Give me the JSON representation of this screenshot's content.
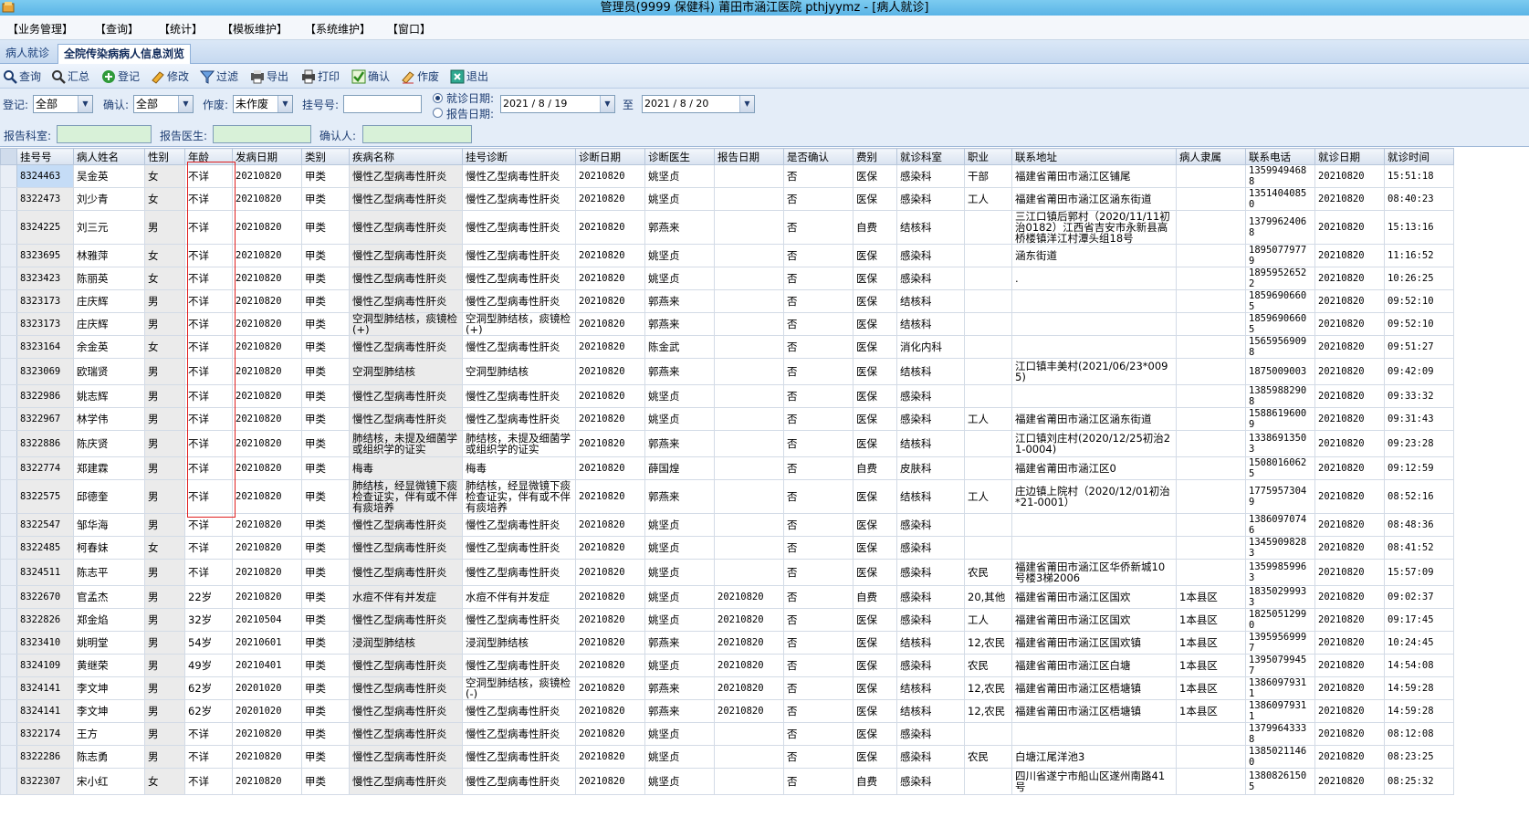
{
  "window": {
    "title": "管理员(9999 保健科) 莆田市涵江医院 pthjyymz - [病人就诊]"
  },
  "menu": [
    "【业务管理】",
    "【查询】",
    "【统计】",
    "【模板维护】",
    "【系统维护】",
    "【窗口】"
  ],
  "tabs": [
    {
      "label": "病人就诊",
      "active": false
    },
    {
      "label": "全院传染病病人信息浏览",
      "active": true
    }
  ],
  "toolbar": [
    {
      "label": "查询",
      "icon": "search-icon"
    },
    {
      "label": "汇总",
      "icon": "summary-icon"
    },
    {
      "label": "登记",
      "icon": "register-icon"
    },
    {
      "label": "修改",
      "icon": "edit-icon"
    },
    {
      "label": "过滤",
      "icon": "filter-icon"
    },
    {
      "label": "导出",
      "icon": "export-icon"
    },
    {
      "label": "打印",
      "icon": "print-icon"
    },
    {
      "label": "确认",
      "icon": "confirm-icon"
    },
    {
      "label": "作废",
      "icon": "void-icon"
    },
    {
      "label": "退出",
      "icon": "exit-icon"
    }
  ],
  "filters": {
    "register_label": "登记:",
    "register_value": "全部",
    "confirm_label": "确认:",
    "confirm_value": "全部",
    "void_label": "作废:",
    "void_value": "未作废",
    "regno_label": "挂号号:",
    "regno_value": "",
    "visit_date_label": "就诊日期:",
    "report_date_label": "报告日期:",
    "date_from": "2021 / 8 / 19",
    "to_label": "至",
    "date_to": "2021 / 8 / 20",
    "report_dept_label": "报告科室:",
    "report_doctor_label": "报告医生:",
    "confirmer_label": "确认人:"
  },
  "columns": [
    "挂号号",
    "病人姓名",
    "性别",
    "年龄",
    "发病日期",
    "类别",
    "疾病名称",
    "挂号诊断",
    "诊断日期",
    "诊断医生",
    "报告日期",
    "是否确认",
    "费别",
    "就诊科室",
    "职业",
    "联系地址",
    "病人隶属",
    "联系电话",
    "就诊日期",
    "就诊时间"
  ],
  "rows": [
    [
      "8324463",
      "吴金英",
      "女",
      "不详",
      "20210820",
      "甲类",
      "慢性乙型病毒性肝炎",
      "慢性乙型病毒性肝炎",
      "20210820",
      "姚坚贞",
      "",
      "否",
      "医保",
      "感染科",
      "干部",
      "福建省莆田市涵江区铺尾",
      "",
      "13599494688",
      "20210820",
      "15:51:18"
    ],
    [
      "8322473",
      "刘少青",
      "女",
      "不详",
      "20210820",
      "甲类",
      "慢性乙型病毒性肝炎",
      "慢性乙型病毒性肝炎",
      "20210820",
      "姚坚贞",
      "",
      "否",
      "医保",
      "感染科",
      "工人",
      "福建省莆田市涵江区涵东街道",
      "",
      "13514040850",
      "20210820",
      "08:40:23"
    ],
    [
      "8324225",
      "刘三元",
      "男",
      "不详",
      "20210820",
      "甲类",
      "慢性乙型病毒性肝炎",
      "慢性乙型病毒性肝炎",
      "20210820",
      "郭燕来",
      "",
      "否",
      "自费",
      "结核科",
      "",
      "三江口镇后郭村（2020/11/11初治0182）江西省吉安市永新县高桥楼镇洋江村潭头组18号",
      "",
      "13799624068",
      "20210820",
      "15:13:16"
    ],
    [
      "8323695",
      "林雅萍",
      "女",
      "不详",
      "20210820",
      "甲类",
      "慢性乙型病毒性肝炎",
      "慢性乙型病毒性肝炎",
      "20210820",
      "姚坚贞",
      "",
      "否",
      "医保",
      "感染科",
      "",
      "涵东街道",
      "",
      "18950779779",
      "20210820",
      "11:16:52"
    ],
    [
      "8323423",
      "陈丽英",
      "女",
      "不详",
      "20210820",
      "甲类",
      "慢性乙型病毒性肝炎",
      "慢性乙型病毒性肝炎",
      "20210820",
      "姚坚贞",
      "",
      "否",
      "医保",
      "感染科",
      "",
      ".",
      "",
      "18959526522",
      "20210820",
      "10:26:25"
    ],
    [
      "8323173",
      "庄庆辉",
      "男",
      "不详",
      "20210820",
      "甲类",
      "慢性乙型病毒性肝炎",
      "慢性乙型病毒性肝炎",
      "20210820",
      "郭燕来",
      "",
      "否",
      "医保",
      "结核科",
      "",
      "",
      "",
      "18596906605",
      "20210820",
      "09:52:10"
    ],
    [
      "8323173",
      "庄庆辉",
      "男",
      "不详",
      "20210820",
      "甲类",
      "空洞型肺结核，痰镜检(+)",
      "空洞型肺结核，痰镜检(+)",
      "20210820",
      "郭燕来",
      "",
      "否",
      "医保",
      "结核科",
      "",
      "",
      "",
      "18596906605",
      "20210820",
      "09:52:10"
    ],
    [
      "8323164",
      "余金英",
      "女",
      "不详",
      "20210820",
      "甲类",
      "慢性乙型病毒性肝炎",
      "慢性乙型病毒性肝炎",
      "20210820",
      "陈金武",
      "",
      "否",
      "医保",
      "消化内科",
      "",
      "",
      "",
      "15659569098",
      "20210820",
      "09:51:27"
    ],
    [
      "8323069",
      "欧瑞贤",
      "男",
      "不详",
      "20210820",
      "甲类",
      "空洞型肺结核",
      "空洞型肺结核",
      "20210820",
      "郭燕来",
      "",
      "否",
      "医保",
      "结核科",
      "",
      "江口镇丰美村(2021/06/23*0095)",
      "",
      "1875009003",
      "20210820",
      "09:42:09"
    ],
    [
      "8322986",
      "姚志辉",
      "男",
      "不详",
      "20210820",
      "甲类",
      "慢性乙型病毒性肝炎",
      "慢性乙型病毒性肝炎",
      "20210820",
      "姚坚贞",
      "",
      "否",
      "医保",
      "感染科",
      "",
      "",
      "",
      "13859882908",
      "20210820",
      "09:33:32"
    ],
    [
      "8322967",
      "林学伟",
      "男",
      "不详",
      "20210820",
      "甲类",
      "慢性乙型病毒性肝炎",
      "慢性乙型病毒性肝炎",
      "20210820",
      "姚坚贞",
      "",
      "否",
      "医保",
      "感染科",
      "工人",
      "福建省莆田市涵江区涵东街道",
      "",
      "15886196009",
      "20210820",
      "09:31:43"
    ],
    [
      "8322886",
      "陈庆贤",
      "男",
      "不详",
      "20210820",
      "甲类",
      "肺结核，未提及细菌学或组织学的证实",
      "肺结核，未提及细菌学或组织学的证实",
      "20210820",
      "郭燕来",
      "",
      "否",
      "医保",
      "结核科",
      "",
      "江口镇刘庄村(2020/12/25初治21-0004)",
      "",
      "13386913503",
      "20210820",
      "09:23:28"
    ],
    [
      "8322774",
      "郑建霖",
      "男",
      "不详",
      "20210820",
      "甲类",
      "梅毒",
      "梅毒",
      "20210820",
      "薛国煌",
      "",
      "否",
      "自费",
      "皮肤科",
      "",
      "福建省莆田市涵江区0",
      "",
      "15080160625",
      "20210820",
      "09:12:59"
    ],
    [
      "8322575",
      "邱德奎",
      "男",
      "不详",
      "20210820",
      "甲类",
      "肺结核，经显微镜下痰检查证实，伴有或不伴有痰培养",
      "肺结核，经显微镜下痰检查证实，伴有或不伴有痰培养",
      "20210820",
      "郭燕来",
      "",
      "否",
      "医保",
      "结核科",
      "工人",
      "庄边镇上院村（2020/12/01初治*21-0001）",
      "",
      "17759573049",
      "20210820",
      "08:52:16"
    ],
    [
      "8322547",
      "邹华海",
      "男",
      "不详",
      "20210820",
      "甲类",
      "慢性乙型病毒性肝炎",
      "慢性乙型病毒性肝炎",
      "20210820",
      "姚坚贞",
      "",
      "否",
      "医保",
      "感染科",
      "",
      "",
      "",
      "13860970746",
      "20210820",
      "08:48:36"
    ],
    [
      "8322485",
      "柯春妹",
      "女",
      "不详",
      "20210820",
      "甲类",
      "慢性乙型病毒性肝炎",
      "慢性乙型病毒性肝炎",
      "20210820",
      "姚坚贞",
      "",
      "否",
      "医保",
      "感染科",
      "",
      "",
      "",
      "13459098283",
      "20210820",
      "08:41:52"
    ],
    [
      "8324511",
      "陈志平",
      "男",
      "不详",
      "20210820",
      "甲类",
      "慢性乙型病毒性肝炎",
      "慢性乙型病毒性肝炎",
      "20210820",
      "姚坚贞",
      "",
      "否",
      "医保",
      "感染科",
      "农民",
      "福建省莆田市涵江区华侨新城10号楼3梯2006",
      "",
      "13599859963",
      "20210820",
      "15:57:09"
    ],
    [
      "8322670",
      "官孟杰",
      "男",
      "22岁",
      "20210820",
      "甲类",
      "水痘不伴有并发症",
      "水痘不伴有并发症",
      "20210820",
      "姚坚贞",
      "20210820",
      "否",
      "自费",
      "感染科",
      "20,其他",
      "福建省莆田市涵江区国欢",
      "1本县区",
      "18350299933",
      "20210820",
      "09:02:37"
    ],
    [
      "8322826",
      "郑金焰",
      "男",
      "32岁",
      "20210504",
      "甲类",
      "慢性乙型病毒性肝炎",
      "慢性乙型病毒性肝炎",
      "20210820",
      "姚坚贞",
      "20210820",
      "否",
      "医保",
      "感染科",
      "工人",
      "福建省莆田市涵江区国欢",
      "1本县区",
      "18250512990",
      "20210820",
      "09:17:45"
    ],
    [
      "8323410",
      "姚明堂",
      "男",
      "54岁",
      "20210601",
      "甲类",
      "浸润型肺结核",
      "浸润型肺结核",
      "20210820",
      "郭燕来",
      "20210820",
      "否",
      "医保",
      "结核科",
      "12,农民",
      "福建省莆田市涵江区国欢镇",
      "1本县区",
      "13959569997",
      "20210820",
      "10:24:45"
    ],
    [
      "8324109",
      "黄继荣",
      "男",
      "49岁",
      "20210401",
      "甲类",
      "慢性乙型病毒性肝炎",
      "慢性乙型病毒性肝炎",
      "20210820",
      "姚坚贞",
      "20210820",
      "否",
      "医保",
      "感染科",
      "农民",
      "福建省莆田市涵江区白塘",
      "1本县区",
      "13950799457",
      "20210820",
      "14:54:08"
    ],
    [
      "8324141",
      "李文坤",
      "男",
      "62岁",
      "20201020",
      "甲类",
      "慢性乙型病毒性肝炎",
      "空洞型肺结核，痰镜检(-)",
      "20210820",
      "郭燕来",
      "20210820",
      "否",
      "医保",
      "结核科",
      "12,农民",
      "福建省莆田市涵江区梧塘镇",
      "1本县区",
      "13860979311",
      "20210820",
      "14:59:28"
    ],
    [
      "8324141",
      "李文坤",
      "男",
      "62岁",
      "20201020",
      "甲类",
      "慢性乙型病毒性肝炎",
      "慢性乙型病毒性肝炎",
      "20210820",
      "郭燕来",
      "20210820",
      "否",
      "医保",
      "结核科",
      "12,农民",
      "福建省莆田市涵江区梧塘镇",
      "1本县区",
      "13860979311",
      "20210820",
      "14:59:28"
    ],
    [
      "8322174",
      "王方",
      "男",
      "不详",
      "20210820",
      "甲类",
      "慢性乙型病毒性肝炎",
      "慢性乙型病毒性肝炎",
      "20210820",
      "姚坚贞",
      "",
      "否",
      "医保",
      "感染科",
      "",
      "",
      "",
      "13799643338",
      "20210820",
      "08:12:08"
    ],
    [
      "8322286",
      "陈志勇",
      "男",
      "不详",
      "20210820",
      "甲类",
      "慢性乙型病毒性肝炎",
      "慢性乙型病毒性肝炎",
      "20210820",
      "姚坚贞",
      "",
      "否",
      "医保",
      "感染科",
      "农民",
      "白塘江尾洋池3",
      "",
      "13850211460",
      "20210820",
      "08:23:25"
    ],
    [
      "8322307",
      "宋小红",
      "女",
      "不详",
      "20210820",
      "甲类",
      "慢性乙型病毒性肝炎",
      "慢性乙型病毒性肝炎",
      "20210820",
      "姚坚贞",
      "",
      "否",
      "自费",
      "感染科",
      "",
      "四川省遂宁市船山区遂州南路41号",
      "",
      "13808261505",
      "20210820",
      "08:25:32"
    ]
  ]
}
